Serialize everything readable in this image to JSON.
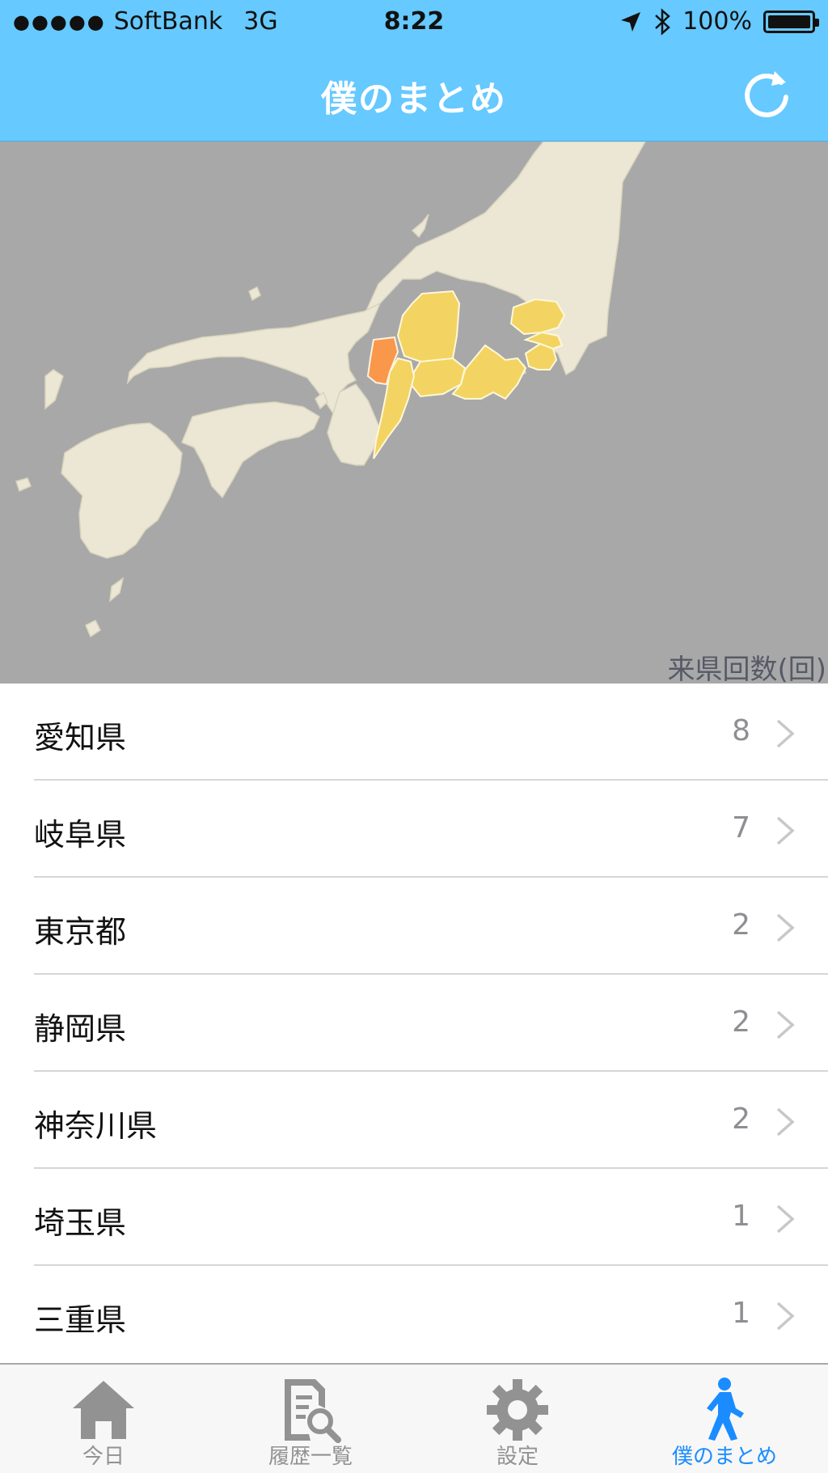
{
  "status_bar": {
    "signal": "●●●●●",
    "carrier": "SoftBank",
    "network": "3G",
    "time": "8:22",
    "battery": "100%"
  },
  "nav": {
    "title": "僕のまとめ",
    "refresh_icon": "refresh-icon"
  },
  "map": {
    "caption": "来県回数(回)",
    "colors": {
      "sea": "#a8a8a8",
      "land": "#ebe7d4",
      "visited": "#f3d462",
      "most_visited": "#f9974a"
    }
  },
  "list": {
    "items": [
      {
        "name": "愛知県",
        "count": "8"
      },
      {
        "name": "岐阜県",
        "count": "7"
      },
      {
        "name": "東京都",
        "count": "2"
      },
      {
        "name": "静岡県",
        "count": "2"
      },
      {
        "name": "神奈川県",
        "count": "2"
      },
      {
        "name": "埼玉県",
        "count": "1"
      },
      {
        "name": "三重県",
        "count": "1"
      }
    ]
  },
  "tabs": [
    {
      "label": "今日",
      "icon": "home-icon"
    },
    {
      "label": "履歴一覧",
      "icon": "history-search-icon"
    },
    {
      "label": "設定",
      "icon": "gear-icon"
    },
    {
      "label": "僕のまとめ",
      "icon": "walking-person-icon"
    }
  ],
  "colors": {
    "accent": "#66c9ff",
    "active_tab": "#1a8cff"
  }
}
